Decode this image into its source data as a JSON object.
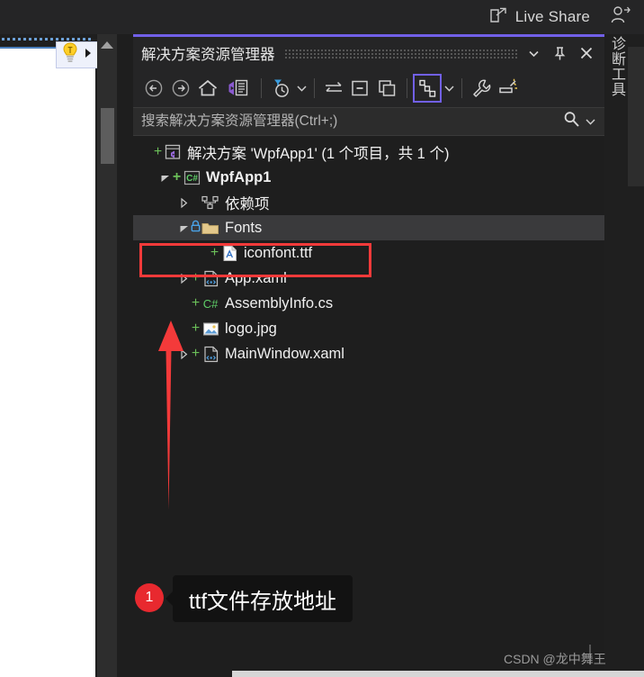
{
  "topbar": {
    "live_share_label": "Live Share",
    "share_icon": "share-icon",
    "person_add_icon": "person-add-icon"
  },
  "editor": {
    "bulb_icon": "lightbulb-icon",
    "bulb_expand_icon": "expand-arrow-icon",
    "scroll_up_icon": "scroll-up-arrow-icon"
  },
  "solution_explorer": {
    "title": "解决方案资源管理器",
    "window_buttons": [
      {
        "name": "window-dropdown-button",
        "icon": "chevron-down-icon"
      },
      {
        "name": "window-pin-button",
        "icon": "pin-icon"
      },
      {
        "name": "window-close-button",
        "icon": "close-icon"
      }
    ],
    "toolbar": [
      {
        "name": "back-button",
        "icon": "arrow-left-circle-icon"
      },
      {
        "name": "forward-button",
        "icon": "arrow-right-circle-icon"
      },
      {
        "name": "home-button",
        "icon": "home-icon"
      },
      {
        "name": "solution-explorer-view-button",
        "icon": "vs-document-icon"
      },
      {
        "name": "pending-changes-filter-button",
        "icon": "filter-clock-icon"
      },
      {
        "name": "pending-changes-dropdown",
        "icon": "chevron-down-icon"
      },
      {
        "name": "sync-with-active-document-button",
        "icon": "sync-arrows-icon"
      },
      {
        "name": "collapse-all-button",
        "icon": "collapse-all-icon"
      },
      {
        "name": "show-all-files-button",
        "icon": "show-all-files-icon"
      },
      {
        "name": "view-class-diagram-button",
        "icon": "object-graph-icon"
      },
      {
        "name": "view-class-diagram-dropdown",
        "icon": "chevron-down-icon"
      },
      {
        "name": "properties-button",
        "icon": "wrench-icon"
      },
      {
        "name": "preview-selected-items-button",
        "icon": "preview-icon"
      }
    ],
    "search": {
      "placeholder": "搜索解决方案资源管理器(Ctrl+;)",
      "search_icon": "search-icon",
      "dropdown_icon": "chevron-down-icon"
    },
    "tree": [
      {
        "label": "解决方案 'WpfApp1' (1 个项目，共 1 个)",
        "indent": 0,
        "twisty": "none",
        "source_control": "+",
        "icon": "solution-icon",
        "bold": false,
        "selected": false
      },
      {
        "label": "WpfApp1",
        "indent": 1,
        "twisty": "expanded",
        "source_control": "+",
        "icon": "csharp-project-icon",
        "bold": true,
        "selected": false
      },
      {
        "label": "依赖项",
        "indent": 2,
        "twisty": "collapsed",
        "source_control": "",
        "icon": "dependencies-icon",
        "bold": false,
        "selected": false
      },
      {
        "label": "Fonts",
        "indent": 2,
        "twisty": "expanded",
        "source_control": "lock",
        "icon": "folder-icon",
        "bold": false,
        "selected": true
      },
      {
        "label": "iconfont.ttf",
        "indent": 3,
        "twisty": "none",
        "source_control": "+",
        "icon": "font-file-icon",
        "bold": false,
        "selected": false
      },
      {
        "label": "App.xaml",
        "indent": 2,
        "twisty": "collapsed",
        "source_control": "+",
        "icon": "xaml-file-icon",
        "bold": false,
        "selected": false
      },
      {
        "label": "AssemblyInfo.cs",
        "indent": 2,
        "twisty": "none",
        "source_control": "+",
        "icon": "csharp-file-icon",
        "bold": false,
        "selected": false
      },
      {
        "label": "logo.jpg",
        "indent": 2,
        "twisty": "none",
        "source_control": "+",
        "icon": "image-file-icon",
        "bold": false,
        "selected": false
      },
      {
        "label": "MainWindow.xaml",
        "indent": 2,
        "twisty": "collapsed",
        "source_control": "+",
        "icon": "xaml-file-icon",
        "bold": false,
        "selected": false
      }
    ]
  },
  "annotations": {
    "step_number": "1",
    "callout_text": "ttf文件存放地址",
    "highlight_box_target": "iconfont.ttf",
    "arrow": "red-up-arrow",
    "accent_red": "#f43a3a",
    "badge_red": "#e8292f"
  },
  "right_tab": {
    "label": "诊断工具"
  },
  "watermark": {
    "text": "CSDN @龙中舞王"
  }
}
